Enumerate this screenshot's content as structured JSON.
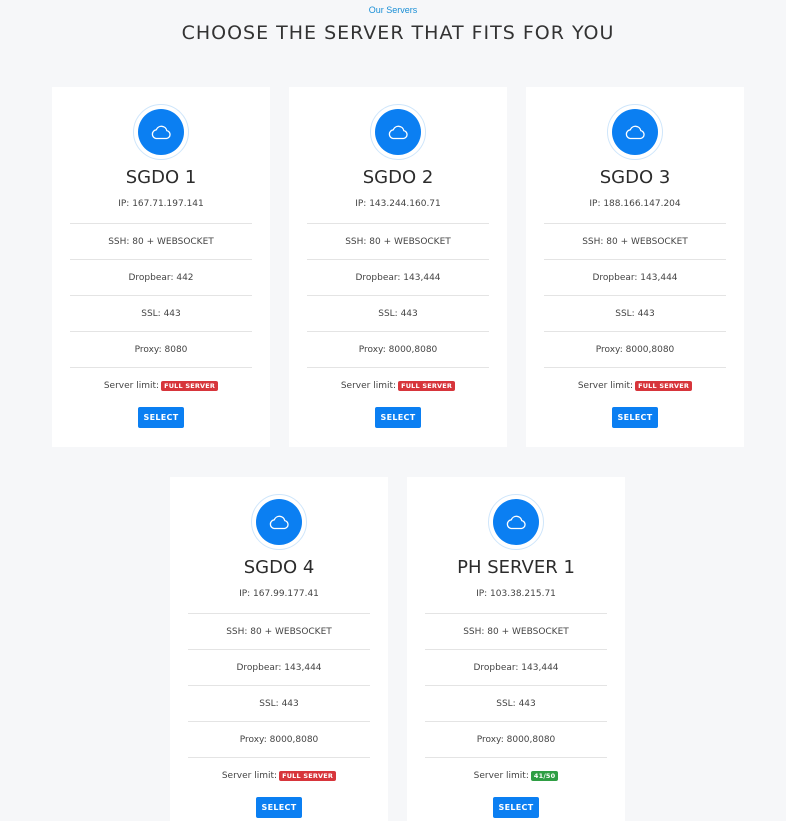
{
  "header": {
    "eyebrow": "Our Servers",
    "title": "CHOOSE THE SERVER THAT FITS FOR YOU"
  },
  "colors": {
    "accent": "#0b7ff2",
    "full": "#d7353b",
    "available": "#2f9e44"
  },
  "icon": "cloud-icon",
  "servers": [
    {
      "name": "SGDO 1",
      "ip": "IP: 167.71.197.141",
      "rows": [
        "SSH: 80 + WEBSOCKET",
        "Dropbear: 442",
        "SSL: 443",
        "Proxy: 8080"
      ],
      "limit_label": "Server limit:",
      "limit_value": "FULL SERVER",
      "limit_status": "full",
      "button": "SELECT"
    },
    {
      "name": "SGDO 2",
      "ip": "IP: 143.244.160.71",
      "rows": [
        "SSH: 80 + WEBSOCKET",
        "Dropbear: 143,444",
        "SSL: 443",
        "Proxy: 8000,8080"
      ],
      "limit_label": "Server limit:",
      "limit_value": "FULL SERVER",
      "limit_status": "full",
      "button": "SELECT"
    },
    {
      "name": "SGDO 3",
      "ip": "IP: 188.166.147.204",
      "rows": [
        "SSH: 80 + WEBSOCKET",
        "Dropbear: 143,444",
        "SSL: 443",
        "Proxy: 8000,8080"
      ],
      "limit_label": "Server limit:",
      "limit_value": "FULL SERVER",
      "limit_status": "full",
      "button": "SELECT"
    },
    {
      "name": "SGDO 4",
      "ip": "IP: 167.99.177.41",
      "rows": [
        "SSH: 80 + WEBSOCKET",
        "Dropbear: 143,444",
        "SSL: 443",
        "Proxy: 8000,8080"
      ],
      "limit_label": "Server limit:",
      "limit_value": "FULL SERVER",
      "limit_status": "full",
      "button": "SELECT"
    },
    {
      "name": "PH SERVER 1",
      "ip": "IP: 103.38.215.71",
      "rows": [
        "SSH: 80 + WEBSOCKET",
        "Dropbear: 143,444",
        "SSL: 443",
        "Proxy: 8000,8080"
      ],
      "limit_label": "Server limit:",
      "limit_value": "41/50",
      "limit_status": "available",
      "button": "SELECT"
    }
  ]
}
